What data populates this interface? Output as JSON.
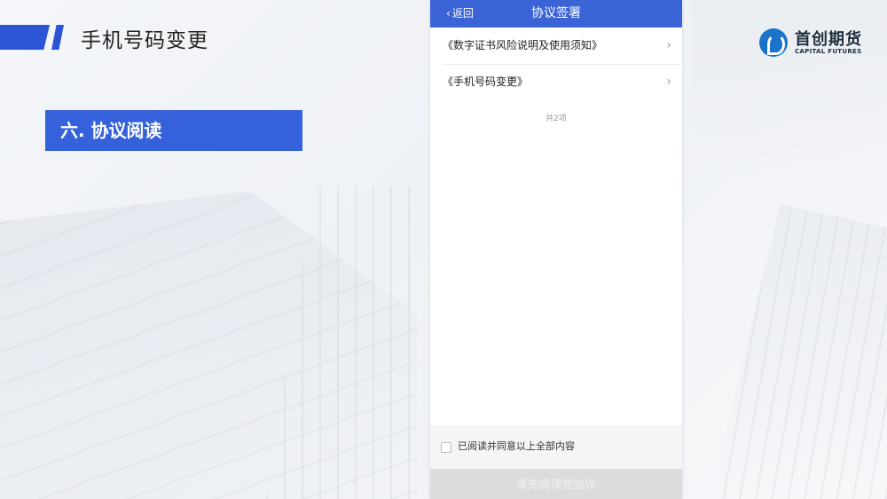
{
  "slide": {
    "title": "手机号码变更",
    "section": "六. 协议阅读"
  },
  "logo": {
    "name_cn": "首创期货",
    "name_en": "CAPITAL FUTURES",
    "icon": "capital-futures-logo-icon",
    "color": "#1a73c8"
  },
  "phone": {
    "nav": {
      "back_label": "返回",
      "back_icon": "chevron-left-icon",
      "title": "协议签署",
      "color": "#3a63d6"
    },
    "items": [
      {
        "label": "《数字证书风险说明及使用须知》",
        "icon": "chevron-right-icon"
      },
      {
        "label": "《手机号码变更》",
        "icon": "chevron-right-icon"
      }
    ],
    "count_text": "共2项",
    "agree_label": "已阅读并同意以上全部内容",
    "agree_checked": false,
    "submit_label": "请先阅读完协议",
    "submit_disabled": true
  },
  "colors": {
    "accent": "#2b54d6",
    "section_bg": "#3561db"
  }
}
